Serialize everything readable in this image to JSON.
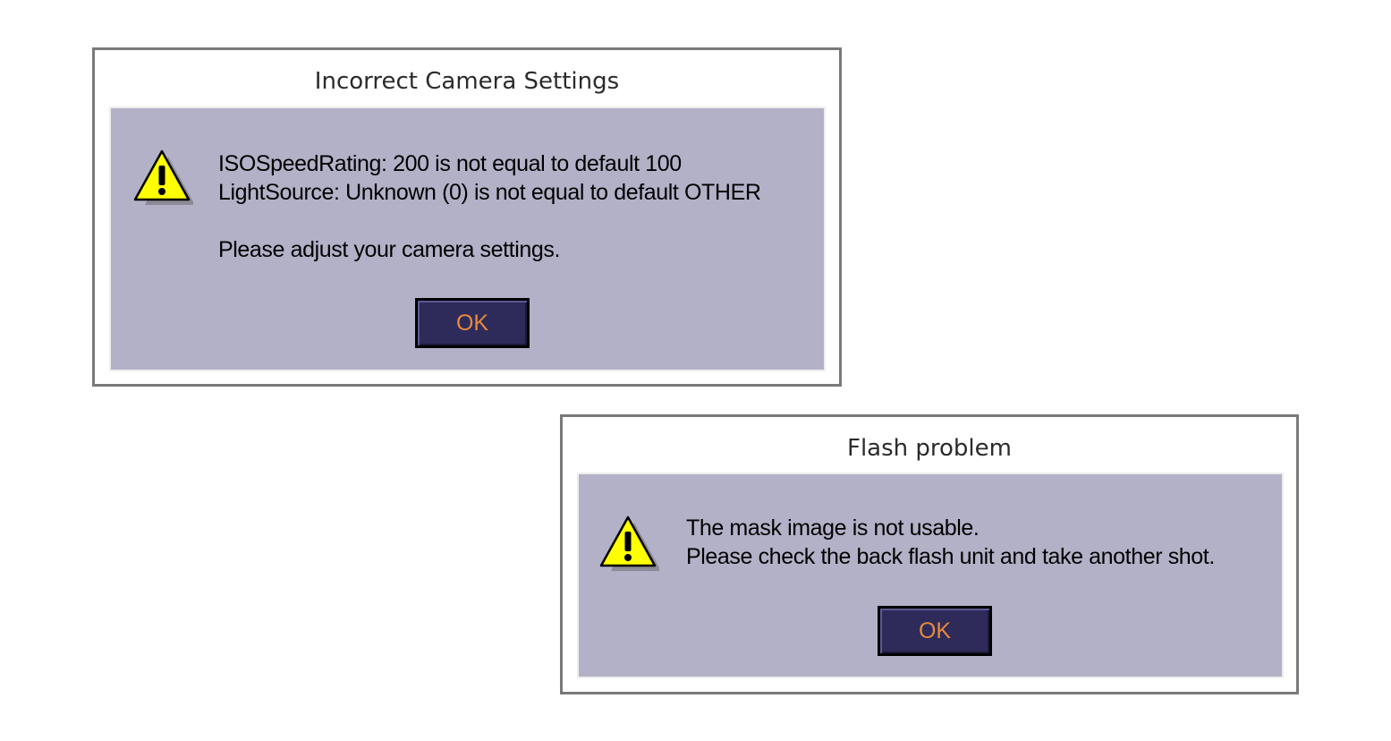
{
  "dialogs": {
    "camera": {
      "title": "Incorrect Camera Settings",
      "icon": "warning-icon",
      "lines": [
        "ISOSpeedRating: 200 is not equal to default 100",
        "LightSource: Unknown (0) is not equal to default OTHER",
        "Please adjust your camera settings."
      ],
      "ok_label": "OK"
    },
    "flash": {
      "title": "Flash problem",
      "icon": "warning-icon",
      "lines": [
        "The mask image is not usable.",
        "Please check the back flash unit and take another shot."
      ],
      "ok_label": "OK"
    }
  },
  "colors": {
    "body_bg": "#b3b1c7",
    "button_bg": "#2e2b5a",
    "button_text": "#e8893c",
    "icon_yellow": "#ffff00"
  }
}
